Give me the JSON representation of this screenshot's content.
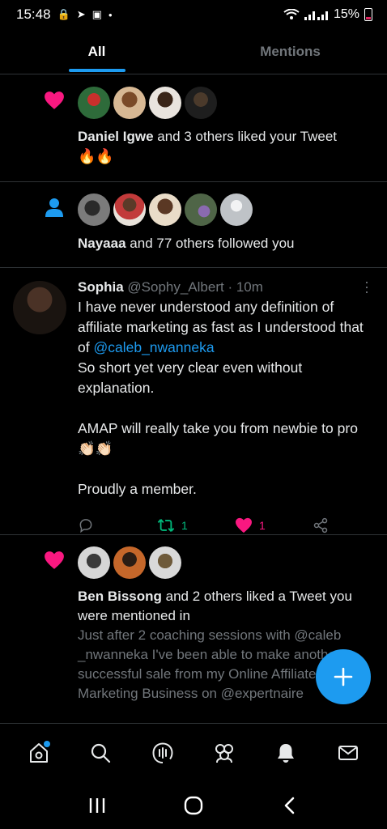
{
  "status_bar": {
    "time": "15:48",
    "battery": "15%"
  },
  "tabs": [
    {
      "label": "All",
      "active": true
    },
    {
      "label": "Mentions",
      "active": false
    }
  ],
  "notifications": [
    {
      "type": "like",
      "actor": "Daniel Igwe",
      "text": " and 3 others liked your Tweet",
      "extra": "🔥🔥",
      "avatars": [
        "#2e6b3a",
        "#a36b3f",
        "#d8d0c8",
        "#2b2b2b"
      ]
    },
    {
      "type": "follow",
      "actor": "Nayaaa",
      "text": " and 77 others followed you",
      "avatars": [
        "#6b6b6b",
        "#c23a3a",
        "#8b5a2b",
        "#5d7050",
        "#bfc3c7"
      ]
    }
  ],
  "tweet": {
    "name": "Sophia",
    "meta": " @Sophy_Albert · 10m",
    "body_1": "I have never understood any definition of affiliate marketing as fast as I understood that of ",
    "mention": "@caleb_nwanneka",
    "body_2": "\nSo short yet very clear even without explanation.\n\nAMAP will really take you from newbie to pro👏🏻👏🏻\n\nProudly a member.",
    "retweets": "1",
    "likes": "1"
  },
  "mention_notification": {
    "actor": "Ben Bissong",
    "text": " and 2 others liked a Tweet you were mentioned in",
    "quoted": "Just after 2 coaching sessions with @caleb _nwanneka  I've been able to make another successful sale from my Online Affiliate Marketing Business on @expertnaire",
    "avatars": [
      "#cfcfcf",
      "#b5642a",
      "#cfcfcf"
    ]
  },
  "colors": {
    "accent": "#1d9bf0",
    "like": "#f91880",
    "retweet": "#00ba7c"
  },
  "icons": {
    "nav": [
      "home-icon",
      "search-icon",
      "spaces-icon",
      "communities-icon",
      "notifications-icon",
      "messages-icon"
    ],
    "system": [
      "recent-apps-icon",
      "home-circle-icon",
      "back-icon"
    ]
  }
}
